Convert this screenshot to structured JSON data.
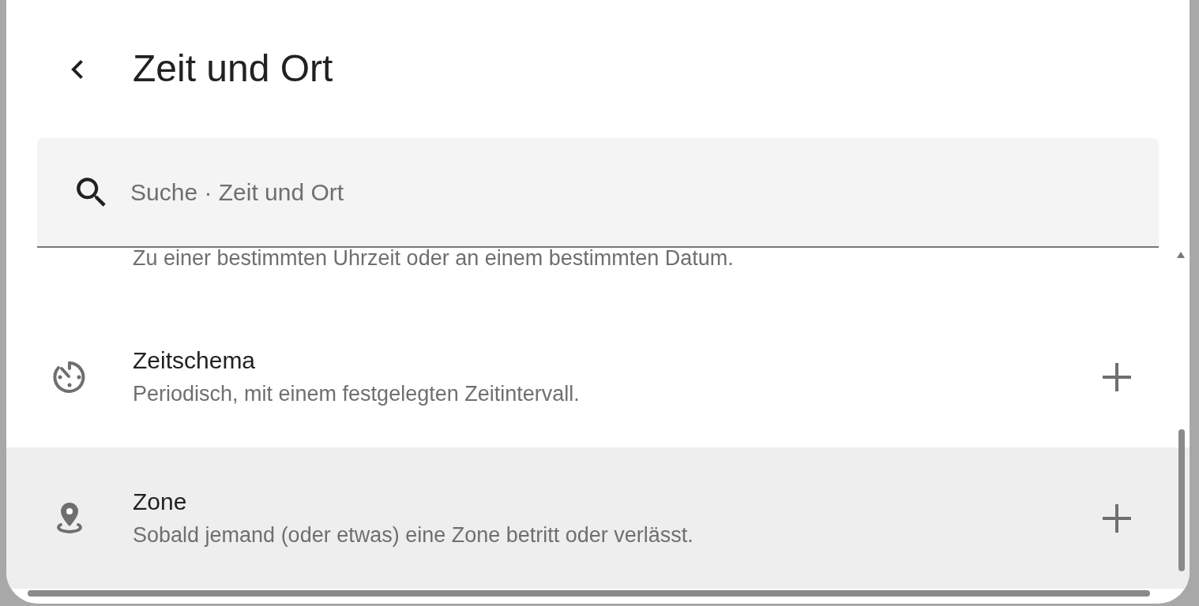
{
  "dialog": {
    "title": "Zeit und Ort"
  },
  "search": {
    "placeholder": "Suche · Zeit und Ort"
  },
  "items": [
    {
      "description": "Zu einer bestimmten Uhrzeit oder an einem bestimmten Datum.",
      "highlighted": false
    },
    {
      "kind": "schedule",
      "title": "Zeitschema",
      "description": "Periodisch, mit einem festgelegten Zeitintervall.",
      "highlighted": false
    },
    {
      "kind": "zone",
      "title": "Zone",
      "description": "Sobald jemand (oder etwas) eine Zone betritt oder verlässt.",
      "highlighted": true
    }
  ]
}
